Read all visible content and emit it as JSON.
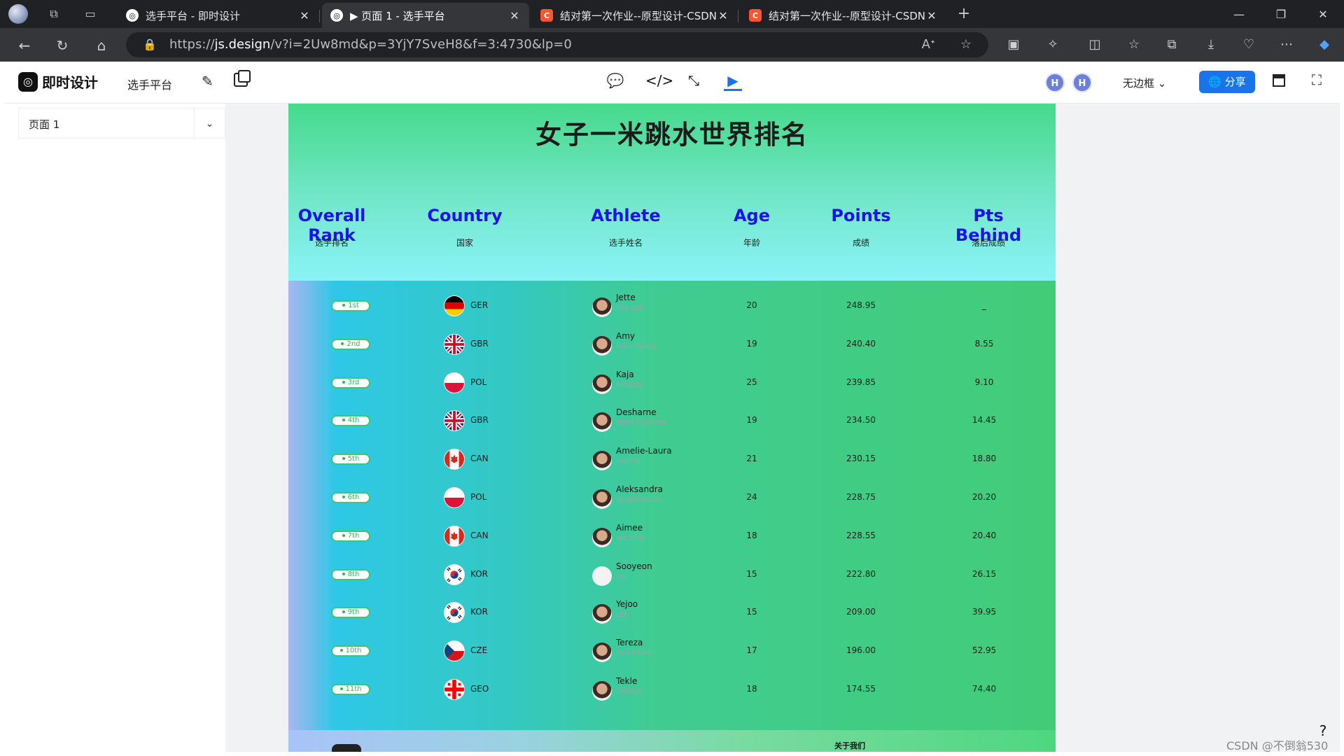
{
  "browser": {
    "tabs": [
      {
        "title": "选手平台 - 即时设计",
        "favicon": "jishi"
      },
      {
        "title": "▶ 页面 1 - 选手平台",
        "favicon": "jishi"
      },
      {
        "title": "结对第一次作业--原型设计-CSDN",
        "favicon": "csdn"
      },
      {
        "title": "结对第一次作业--原型设计-CSDN",
        "favicon": "csdn"
      }
    ],
    "new_tab": "+",
    "url_prefix": "https://",
    "url_host": "js.design",
    "url_rest": "/v?i=2Uw8md&p=3YjY7SveH8&f=3:4730&lp=0",
    "window_controls": [
      "—",
      "❐",
      "✕"
    ]
  },
  "app": {
    "logo_mark": "◎",
    "logo_text": "即时设计",
    "project_name": "选手平台",
    "avatars": [
      "H",
      "H"
    ],
    "frame_mode": "无边框",
    "share_label": "分享",
    "page_select": "页面 1",
    "help": "?"
  },
  "colors": {
    "accent": "#1a73e8",
    "header_text": "#1f12e8",
    "badge": "#3cc774"
  },
  "ranking": {
    "title": "女子一米跳水世界排名",
    "columns": [
      {
        "label": "Overall Rank",
        "sub": "选手排名"
      },
      {
        "label": "Country",
        "sub": "国家"
      },
      {
        "label": "Athlete",
        "sub": "选手姓名"
      },
      {
        "label": "Age",
        "sub": "年龄"
      },
      {
        "label": "Points",
        "sub": "成绩"
      },
      {
        "label": "Pts Behind",
        "sub": "落后成绩"
      }
    ],
    "rows": [
      {
        "rank": "1st",
        "country": "GER",
        "first": "Jette",
        "last": "MÜLLER",
        "age": "20",
        "points": "248.95",
        "behind": "_"
      },
      {
        "rank": "2nd",
        "country": "GBR",
        "first": "Amy",
        "last": "ROLLINSON",
        "age": "19",
        "points": "240.40",
        "behind": "8.55"
      },
      {
        "rank": "3rd",
        "country": "POL",
        "first": "Kaja",
        "last": "SKRZEK",
        "age": "25",
        "points": "239.85",
        "behind": "9.10"
      },
      {
        "rank": "4th",
        "country": "GBR",
        "first": "Desharne",
        "last": "BENT-ASHMEIL",
        "age": "19",
        "points": "234.50",
        "behind": "14.45"
      },
      {
        "rank": "5th",
        "country": "CAN",
        "first": "Amelie-Laura",
        "last": "JASMIN",
        "age": "21",
        "points": "230.15",
        "behind": "18.80"
      },
      {
        "rank": "6th",
        "country": "POL",
        "first": "Aleksandra",
        "last": "BLAZOWSKA",
        "age": "24",
        "points": "228.75",
        "behind": "20.20"
      },
      {
        "rank": "7th",
        "country": "CAN",
        "first": "Aimee",
        "last": "WILSON",
        "age": "18",
        "points": "228.55",
        "behind": "20.40"
      },
      {
        "rank": "8th",
        "country": "KOR",
        "first": "Sooyeon",
        "last": "OH",
        "age": "15",
        "points": "222.80",
        "behind": "26.15"
      },
      {
        "rank": "9th",
        "country": "KOR",
        "first": "Yejoo",
        "last": "LEE",
        "age": "15",
        "points": "209.00",
        "behind": "39.95"
      },
      {
        "rank": "10th",
        "country": "CZE",
        "first": "Tereza",
        "last": "JELINKOVA",
        "age": "17",
        "points": "196.00",
        "behind": "52.95"
      },
      {
        "rank": "11th",
        "country": "GEO",
        "first": "Tekle",
        "last": "SHARIA",
        "age": "18",
        "points": "174.55",
        "behind": "74.40"
      }
    ],
    "footer_about": "关于我们"
  },
  "watermark": "CSDN @不倒翁530"
}
